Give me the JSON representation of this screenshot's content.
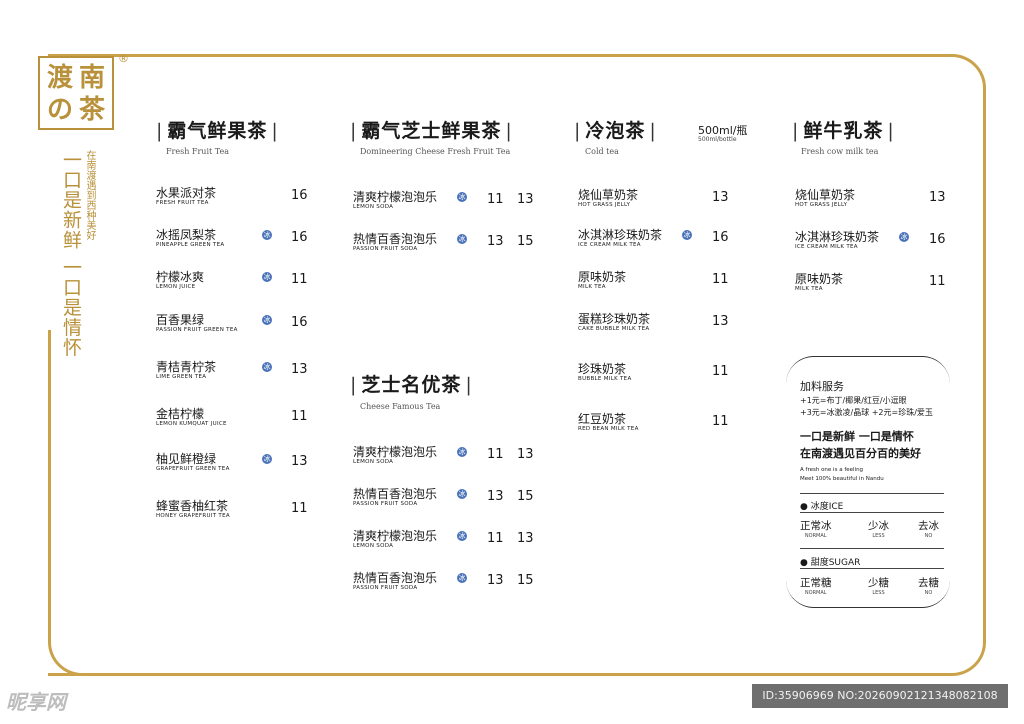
{
  "brand": {
    "logo_chars": [
      "渡",
      "南",
      "の",
      "茶"
    ],
    "reg_mark": "®",
    "slogan_main": "一口是新鲜 一口是情怀",
    "slogan_sub": "在南渡遇到西种美好"
  },
  "colors": {
    "gold": "#b8913a",
    "ice_badge": "#4a72b8"
  },
  "sections": [
    {
      "title": "霸气鲜果茶",
      "subtitle": "Fresh Fruit Tea",
      "items": [
        {
          "cn": "水果派对茶",
          "en": "FRESH FRUIT TEA",
          "ice": false,
          "p1": "16",
          "p2": ""
        },
        {
          "cn": "冰摇凤梨茶",
          "en": "PINEAPPLE GREEN TEA",
          "ice": true,
          "p1": "16",
          "p2": ""
        },
        {
          "cn": "柠檬冰爽",
          "en": "LEMON JUICE",
          "ice": true,
          "p1": "11",
          "p2": ""
        },
        {
          "cn": "百香果绿",
          "en": "PASSION FRUIT GREEN TEA",
          "ice": true,
          "p1": "16",
          "p2": ""
        },
        {
          "cn": "青桔青柠茶",
          "en": "LIME GREEN TEA",
          "ice": true,
          "p1": "13",
          "p2": ""
        },
        {
          "cn": "金桔柠檬",
          "en": "LEMON KUMQUAT JUICE",
          "ice": false,
          "p1": "11",
          "p2": ""
        },
        {
          "cn": "柚见鲜橙绿",
          "en": "GRAPEFRUIT GREEN TEA",
          "ice": true,
          "p1": "13",
          "p2": ""
        },
        {
          "cn": "蜂蜜香柚红茶",
          "en": "HONEY GRAPEFRUIT TEA",
          "ice": false,
          "p1": "11",
          "p2": ""
        }
      ]
    },
    {
      "title": "霸气芝士鲜果茶",
      "subtitle": "Domineering Cheese Fresh Fruit Tea",
      "items": [
        {
          "cn": "清爽柠檬泡泡乐",
          "en": "LEMON SODA",
          "ice": true,
          "p1": "11",
          "p2": "13"
        },
        {
          "cn": "热情百香泡泡乐",
          "en": "PASSION FRUIT SODA",
          "ice": true,
          "p1": "13",
          "p2": "15"
        }
      ]
    },
    {
      "title": "芝士名优茶",
      "subtitle": "Cheese Famous Tea",
      "items": [
        {
          "cn": "清爽柠檬泡泡乐",
          "en": "LEMON SODA",
          "ice": true,
          "p1": "11",
          "p2": "13"
        },
        {
          "cn": "热情百香泡泡乐",
          "en": "PASSION FRUIT SODA",
          "ice": true,
          "p1": "13",
          "p2": "15"
        },
        {
          "cn": "清爽柠檬泡泡乐",
          "en": "LEMON SODA",
          "ice": true,
          "p1": "11",
          "p2": "13"
        },
        {
          "cn": "热情百香泡泡乐",
          "en": "PASSION FRUIT SODA",
          "ice": true,
          "p1": "13",
          "p2": "15"
        }
      ]
    },
    {
      "title": "冷泡茶",
      "subtitle": "Cold tea",
      "size_note": "500ml/瓶",
      "size_note_en": "500ml/bottle",
      "items": [
        {
          "cn": "烧仙草奶茶",
          "en": "HOT GRASS JELLY",
          "ice": false,
          "p1": "13",
          "p2": ""
        },
        {
          "cn": "冰淇淋珍珠奶茶",
          "en": "ICE CREAM MILK TEA",
          "ice": true,
          "p1": "16",
          "p2": ""
        },
        {
          "cn": "原味奶茶",
          "en": "MILK TEA",
          "ice": false,
          "p1": "11",
          "p2": ""
        },
        {
          "cn": "蛋糕珍珠奶茶",
          "en": "CAKE BUBBLE MILK TEA",
          "ice": false,
          "p1": "13",
          "p2": ""
        },
        {
          "cn": "珍珠奶茶",
          "en": "BUBBLE MILK TEA",
          "ice": false,
          "p1": "11",
          "p2": ""
        },
        {
          "cn": "红豆奶茶",
          "en": "RED BEAN MILK TEA",
          "ice": false,
          "p1": "11",
          "p2": ""
        }
      ]
    },
    {
      "title": "鲜牛乳茶",
      "subtitle": "Fresh cow milk tea",
      "items": [
        {
          "cn": "烧仙草奶茶",
          "en": "HOT GRASS JELLY",
          "ice": false,
          "p1": "13",
          "p2": ""
        },
        {
          "cn": "冰淇淋珍珠奶茶",
          "en": "ICE CREAM MILK TEA",
          "ice": true,
          "p1": "16",
          "p2": ""
        },
        {
          "cn": "原味奶茶",
          "en": "MILK TEA",
          "ice": false,
          "p1": "11",
          "p2": ""
        }
      ]
    }
  ],
  "ice_badge_label": "冰",
  "addon": {
    "title": "加料服务",
    "line1": "+1元=布丁/椰果/红豆/小逗眼",
    "line2": "+3元=冰激凌/晶球 +2元=珍珠/爱玉",
    "slogan1": "一口是新鲜 一口是情怀",
    "slogan2": "在南渡遇见百分百的美好",
    "en1": "A fresh one is a feeling",
    "en2": "Meet 100% beautiful in Nandu",
    "ice_head": "● 冰度ICE",
    "ice_options": [
      {
        "cn": "正常冰",
        "en": "NORMAL"
      },
      {
        "cn": "少冰",
        "en": "LESS"
      },
      {
        "cn": "去冰",
        "en": "NO"
      }
    ],
    "sugar_head": "● 甜度SUGAR",
    "sugar_options": [
      {
        "cn": "正常糖",
        "en": "NORMAL"
      },
      {
        "cn": "少糖",
        "en": "LESS"
      },
      {
        "cn": "去糖",
        "en": "NO"
      }
    ]
  },
  "watermark": {
    "left": "昵享网",
    "right": "ID:35906969 NO:20260902121348082108"
  }
}
